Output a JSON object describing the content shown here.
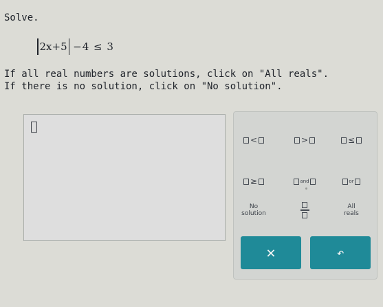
{
  "prompt": "Solve.",
  "expression": {
    "inside_abs": "2x+5",
    "rest": "−4 ≤ 3"
  },
  "instructions": [
    "If all real numbers are solutions, click on \"All reals\".",
    "If there is no solution, click on \"No solution\"."
  ],
  "keypad": {
    "row1": {
      "lt": "<",
      "gt": ">",
      "le": "≤"
    },
    "row2": {
      "ge": "≥",
      "and": "and",
      "or": "or"
    },
    "row3": {
      "no_solution_line1": "No",
      "no_solution_line2": "solution",
      "all_reals_line1": "All",
      "all_reals_line2": "reals"
    },
    "clear_symbol": "✕",
    "undo_symbol": "↶"
  },
  "colors": {
    "action_button": "#1f8a98",
    "background": "#dcdcd6"
  }
}
